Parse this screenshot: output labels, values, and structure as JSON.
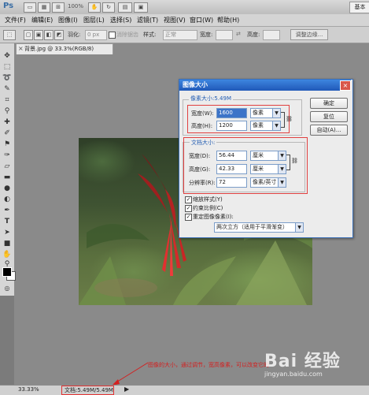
{
  "app": {
    "logo": "Ps",
    "zoom_readout": "100%",
    "workspace_button": "基本"
  },
  "menu": [
    "文件(F)",
    "编辑(E)",
    "图像(I)",
    "图层(L)",
    "选择(S)",
    "滤镜(T)",
    "视图(V)",
    "窗口(W)",
    "帮助(H)"
  ],
  "options_bar": {
    "feather_label": "羽化:",
    "feather_value": "0 px",
    "antialias_label": "消除锯齿",
    "style_label": "样式:",
    "style_value": "正常",
    "width_label": "宽度:",
    "height_label": "高度:",
    "refine_edge": "调整边缘..."
  },
  "document_tab": {
    "title": "背景.jpg @ 33.3%(RGB/8)",
    "close_icon": "×"
  },
  "toolbox": {
    "tools": [
      "move-tool",
      "marquee-tool",
      "lasso-tool",
      "quick-select-tool",
      "crop-tool",
      "eyedropper-tool",
      "healing-tool",
      "brush-tool",
      "clone-tool",
      "history-brush-tool",
      "eraser-tool",
      "gradient-tool",
      "blur-tool",
      "dodge-tool",
      "pen-tool",
      "type-tool",
      "path-select-tool",
      "shape-tool",
      "hand-tool",
      "zoom-tool"
    ]
  },
  "dialog": {
    "title": "图像大小",
    "close_icon": "×",
    "pixel_dimensions_label": "像素大小:5.49M",
    "pixel_width_label": "宽度(W):",
    "pixel_width_value": "1600",
    "pixel_width_unit": "像素",
    "pixel_height_label": "高度(H):",
    "pixel_height_value": "1200",
    "pixel_height_unit": "像素",
    "doc_size_label": "文档大小:",
    "doc_width_label": "宽度(D):",
    "doc_width_value": "56.44",
    "doc_width_unit": "厘米",
    "doc_height_label": "高度(G):",
    "doc_height_value": "42.33",
    "doc_height_unit": "厘米",
    "resolution_label": "分辨率(R):",
    "resolution_value": "72",
    "resolution_unit": "像素/英寸",
    "scale_styles": "缩放样式(Y)",
    "constrain_proportions": "约束比例(C)",
    "resample": "重定图像像素(I):",
    "resample_method": "两次立方（适用于平滑渐变）",
    "ok_button": "确定",
    "reset_button": "复位",
    "auto_button": "自动(A)..."
  },
  "status_bar": {
    "zoom": "33.33%",
    "doc_info": "文档:5.49M/5.49M",
    "arrow": "▶"
  },
  "annotation": {
    "text": "图像的大小，通过调节，宽高像素，可以改变它的"
  },
  "watermark": {
    "main": "Bai 经验",
    "sub": "jingyan.baidu.com"
  },
  "colors": {
    "accent_blue": "#2058b8",
    "annotation_red": "#d32020"
  }
}
